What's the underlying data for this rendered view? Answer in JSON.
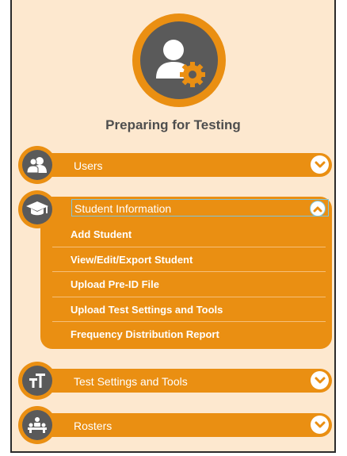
{
  "page": {
    "title": "Preparing for Testing"
  },
  "hero_icon": "user-gear-icon",
  "colors": {
    "accent": "#ea8f12",
    "icon_bg": "#5a5a5a",
    "background": "#fde8cf",
    "title_text": "#4e4e4e"
  },
  "sections": {
    "users": {
      "label": "Users",
      "icon": "users-icon",
      "state": "collapsed"
    },
    "student_information": {
      "label": "Student Information",
      "icon": "graduation-cap-icon",
      "state": "expanded",
      "items": [
        {
          "label": "Add Student"
        },
        {
          "label": "View/Edit/Export Student"
        },
        {
          "label": "Upload Pre-ID File"
        },
        {
          "label": "Upload Test Settings and Tools"
        },
        {
          "label": "Frequency Distribution Report"
        }
      ]
    },
    "test_settings": {
      "label": "Test Settings and Tools",
      "icon": "text-size-icon",
      "state": "collapsed"
    },
    "rosters": {
      "label": "Rosters",
      "icon": "classroom-icon",
      "state": "collapsed"
    }
  }
}
